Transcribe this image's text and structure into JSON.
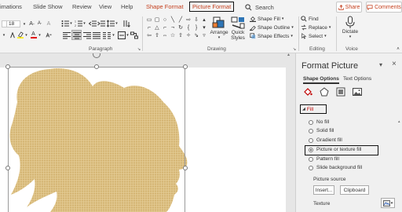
{
  "tabs": {
    "animations": "imations",
    "slide_show": "Slide Show",
    "review": "Review",
    "view": "View",
    "help": "Help",
    "shape_format": "Shape Format",
    "picture_format": "Picture Format",
    "search": "Search",
    "share": "Share",
    "comments": "Comments"
  },
  "ribbon": {
    "font_size": "18",
    "groups": {
      "paragraph": "Paragraph",
      "drawing": "Drawing",
      "editing": "Editing",
      "voice": "Voice"
    },
    "arrange": "Arrange",
    "quick_styles": "Quick Styles",
    "shape_fill": "Shape Fill",
    "shape_outline": "Shape Outline",
    "shape_effects": "Shape Effects",
    "find": "Find",
    "replace": "Replace",
    "select": "Select",
    "dictate": "Dictate"
  },
  "pane": {
    "title": "Format Picture",
    "tab_shape_options": "Shape Options",
    "tab_text_options": "Text Options",
    "fill_header": "Fill",
    "options": {
      "no_fill": "No fill",
      "solid_fill": "Solid fill",
      "gradient_fill": "Gradient fill",
      "picture_or_texture_fill": "Picture or texture fill",
      "pattern_fill": "Pattern fill",
      "slide_background_fill": "Slide background fill"
    },
    "selected_option": "Picture or texture fill",
    "picture_source": "Picture source",
    "insert": "Insert...",
    "clipboard": "Clipboard",
    "texture": "Texture"
  },
  "colors": {
    "accent": "#c43e1c",
    "texture_fill": "#d9bd7f"
  }
}
